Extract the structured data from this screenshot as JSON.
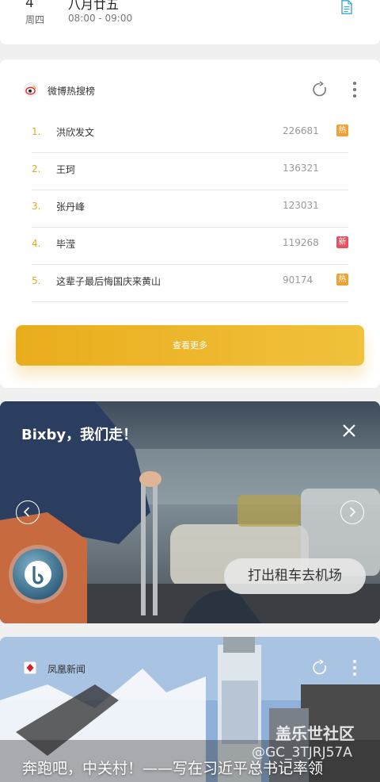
{
  "calendar": {
    "day": "4",
    "weekday": "周四",
    "title": "八月廿五",
    "time": "08:00 - 09:00",
    "icon": "document-icon"
  },
  "weibo": {
    "title": "微博热搜榜",
    "logo": "weibo-logo",
    "items": [
      {
        "rank": "1.",
        "name": "洪欣发文",
        "count": "226681",
        "badge": "热",
        "badge_color": "#f0a132"
      },
      {
        "rank": "2.",
        "name": "王珂",
        "count": "136321",
        "badge": "",
        "badge_color": ""
      },
      {
        "rank": "3.",
        "name": "张丹峰",
        "count": "123031",
        "badge": "",
        "badge_color": ""
      },
      {
        "rank": "4.",
        "name": "毕滢",
        "count": "119268",
        "badge": "新",
        "badge_color": "#ea4f5f"
      },
      {
        "rank": "5.",
        "name": "这辈子最后悔国庆来黄山",
        "count": "90174",
        "badge": "热",
        "badge_color": "#f0a132"
      }
    ],
    "more_label": "查看更多",
    "accent": "#e9ad1c"
  },
  "bixby": {
    "title": "Bixby，我们走！",
    "suggestion": "打出租车去机场",
    "icons": [
      "close-icon",
      "chevron-left-icon",
      "chevron-right-icon",
      "bixby-logo"
    ]
  },
  "news": {
    "source": "凤凰新闻",
    "headline": "奔跑吧，中关村！——写在习近平总书记率领",
    "watermark": "盖乐世社区",
    "watermark_id": "@GC_3TJRJ57A"
  }
}
